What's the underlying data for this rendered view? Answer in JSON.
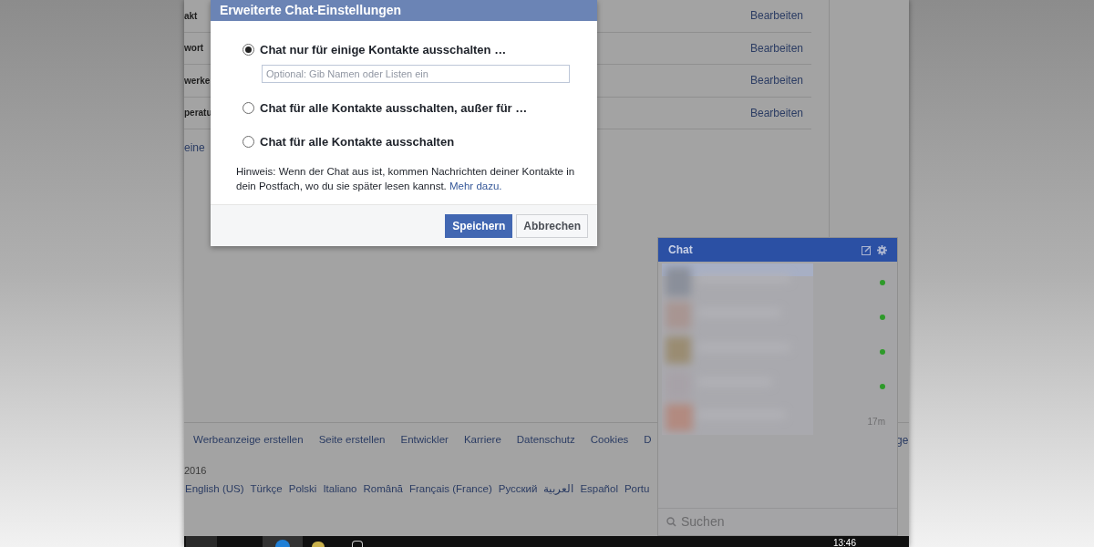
{
  "settings_rows": [
    {
      "label": "akt",
      "action": "Bearbeiten"
    },
    {
      "label": "wort",
      "action": "Bearbeiten"
    },
    {
      "label": "werke",
      "action": "Bearbeiten"
    },
    {
      "label": "peratu",
      "action": "Bearbeiten"
    }
  ],
  "partial_link": "eine",
  "dialog": {
    "title": "Erweiterte Chat-Einstellungen",
    "options": [
      {
        "label": "Chat nur für einige Kontakte ausschalten …",
        "selected": true,
        "placeholder": "Optional: Gib Namen oder Listen ein"
      },
      {
        "label": "Chat für alle Kontakte ausschalten, außer für …",
        "selected": false
      },
      {
        "label": "Chat für alle Kontakte ausschalten",
        "selected": false
      }
    ],
    "hint": "Hinweis: Wenn der Chat aus ist, kommen Nachrichten deiner Kontakte in dein Postfach, wo du sie später lesen kannst.",
    "hint_link": "Mehr dazu.",
    "buttons": [
      {
        "label": "Speichern",
        "kind": "primary"
      },
      {
        "label": "Abbrechen",
        "kind": "secondary"
      }
    ]
  },
  "footer": {
    "links": [
      "Werbeanzeige erstellen",
      "Seite erstellen",
      "Entwickler",
      "Karriere",
      "Datenschutz",
      "Cookies",
      "D"
    ],
    "cut_link": "ge",
    "copyright": "2016",
    "languages": [
      "English (US)",
      "Türkçe",
      "Polski",
      "Italiano",
      "Română",
      "Français (France)",
      "Русский",
      "العربية",
      "Español",
      "Portu"
    ]
  },
  "chat": {
    "title": "Chat",
    "contacts": [
      {
        "online": true
      },
      {
        "online": true
      },
      {
        "online": true
      },
      {
        "online": true
      },
      {
        "online": false,
        "time": "17m"
      }
    ],
    "search_placeholder": "Suchen"
  },
  "taskbar": {
    "clock": "13:46"
  }
}
